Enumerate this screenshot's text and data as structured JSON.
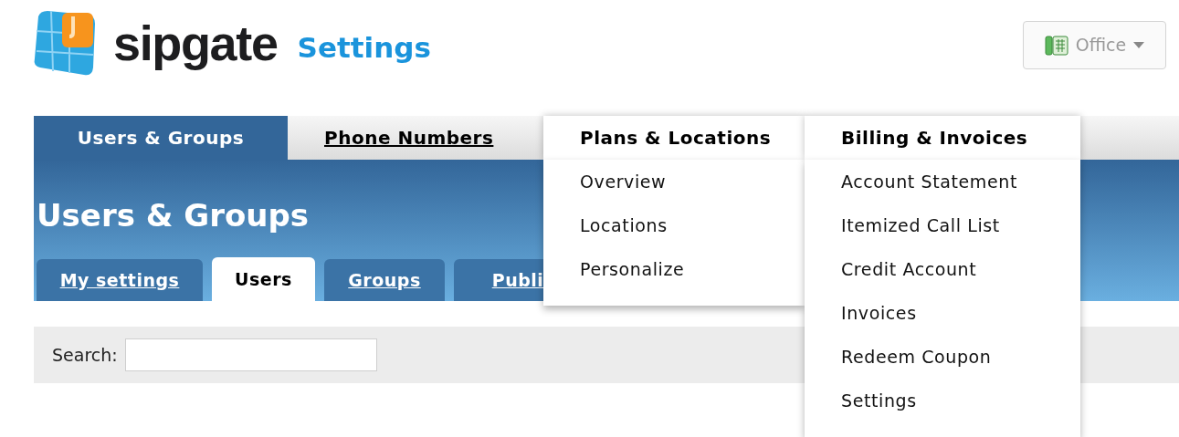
{
  "header": {
    "logo_text": "sipgate",
    "section_title": "Settings",
    "account_button": {
      "label": "Office"
    }
  },
  "nav": [
    {
      "label": "Users & Groups",
      "selected": true,
      "expanded": false
    },
    {
      "label": "Phone Numbers",
      "selected": false,
      "expanded": false
    },
    {
      "label": "Plans & Locations",
      "selected": false,
      "expanded": true,
      "children": [
        "Overview",
        "Locations",
        "Personalize"
      ]
    },
    {
      "label": "Billing & Invoices",
      "selected": false,
      "expanded": true,
      "children": [
        "Account Statement",
        "Itemized Call List",
        "Credit Account",
        "Invoices",
        "Redeem Coupon",
        "Settings"
      ]
    }
  ],
  "page_title": "Users & Groups",
  "subtabs": [
    {
      "label": "My settings",
      "selected": false
    },
    {
      "label": "Users",
      "selected": true
    },
    {
      "label": "Groups",
      "selected": false
    },
    {
      "label": "Publi",
      "selected": false
    }
  ],
  "search": {
    "label": "Search:"
  }
}
